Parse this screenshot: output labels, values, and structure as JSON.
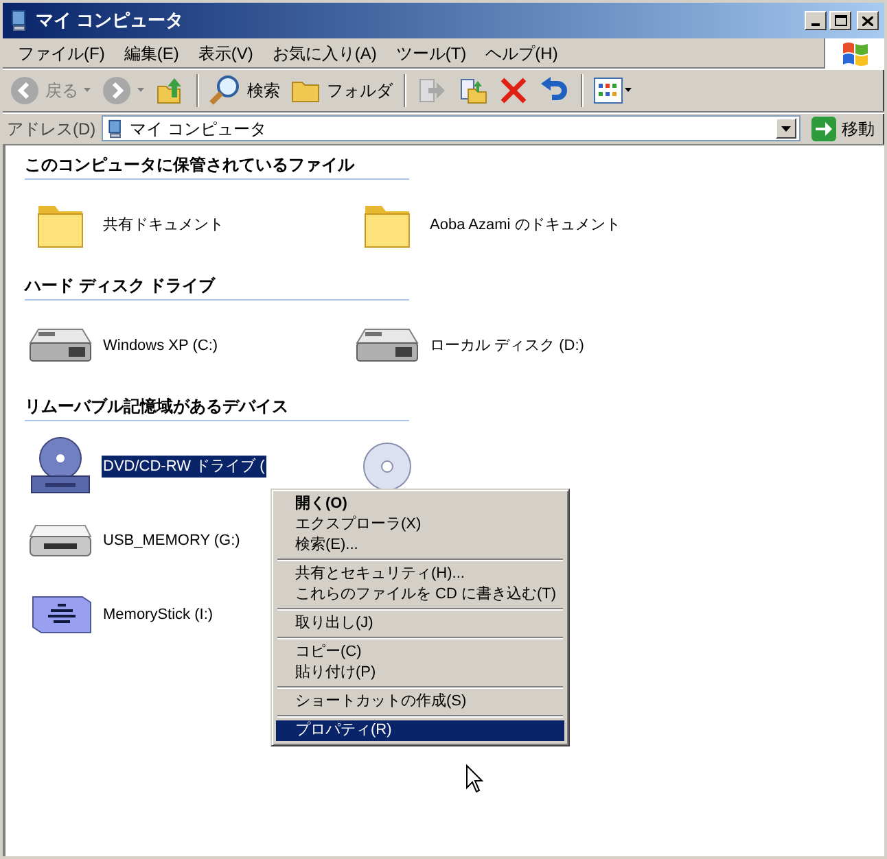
{
  "window": {
    "title": "マイ コンピュータ"
  },
  "menu_bar": [
    "ファイル(F)",
    "編集(E)",
    "表示(V)",
    "お気に入り(A)",
    "ツール(T)",
    "ヘルプ(H)"
  ],
  "toolbar": [
    {
      "kind": "back",
      "label": "戻る",
      "disabled": true
    },
    {
      "kind": "forward",
      "disabled": true
    },
    {
      "kind": "up",
      "disabled": false
    },
    {
      "kind": "search",
      "label": "検索",
      "disabled": false
    },
    {
      "kind": "folders",
      "label": "フォルダ",
      "disabled": false
    },
    {
      "kind": "move",
      "disabled": true
    },
    {
      "kind": "copy",
      "disabled": false
    },
    {
      "kind": "delete",
      "disabled": false
    },
    {
      "kind": "undo",
      "disabled": false
    },
    {
      "kind": "views",
      "disabled": false
    }
  ],
  "address_bar": {
    "label": "アドレス(D)",
    "value": "マイ コンピュータ",
    "go": "移動"
  },
  "sections": [
    {
      "title": "このコンピュータに保管されているファイル",
      "rows": [
        [
          {
            "kind": "folder",
            "label": "共有ドキュメント",
            "selected": false
          },
          {
            "kind": "folder",
            "label": "Aoba Azami のドキュメント",
            "selected": false
          }
        ]
      ]
    },
    {
      "title": "ハード ディスク ドライブ",
      "rows": [
        [
          {
            "kind": "hdd",
            "label": "Windows XP (C:)",
            "selected": false
          },
          {
            "kind": "hdd",
            "label": "ローカル ディスク (D:)",
            "selected": false
          }
        ]
      ]
    },
    {
      "title": "リムーバブル記憶域があるデバイス",
      "rows": [
        [
          {
            "kind": "dvdrw",
            "label": "DVD/CD-RW ドライブ (",
            "selected": true
          },
          {
            "kind": "dvd",
            "selected": false
          }
        ],
        [
          {
            "kind": "usb",
            "label": "USB_MEMORY (G:)",
            "selected": false
          }
        ],
        [
          {
            "kind": "memorystick",
            "label": "MemoryStick (I:)",
            "selected": false
          }
        ]
      ]
    }
  ],
  "context_menu": {
    "groups": [
      [
        {
          "label": "開く(O)",
          "default": true,
          "selected": false
        },
        {
          "label": "エクスプローラ(X)",
          "default": false,
          "selected": false
        },
        {
          "label": "検索(E)...",
          "default": false,
          "selected": false
        }
      ],
      [
        {
          "label": "共有とセキュリティ(H)...",
          "default": false,
          "selected": false
        },
        {
          "label": "これらのファイルを CD に書き込む(T)",
          "default": false,
          "selected": false
        }
      ],
      [
        {
          "label": "取り出し(J)",
          "default": false,
          "selected": false
        }
      ],
      [
        {
          "label": "コピー(C)",
          "default": false,
          "selected": false
        },
        {
          "label": "貼り付け(P)",
          "default": false,
          "selected": false
        }
      ],
      [
        {
          "label": "ショートカットの作成(S)",
          "default": false,
          "selected": false
        }
      ],
      [
        {
          "label": "プロパティ(R)",
          "default": false,
          "selected": true
        }
      ]
    ]
  }
}
